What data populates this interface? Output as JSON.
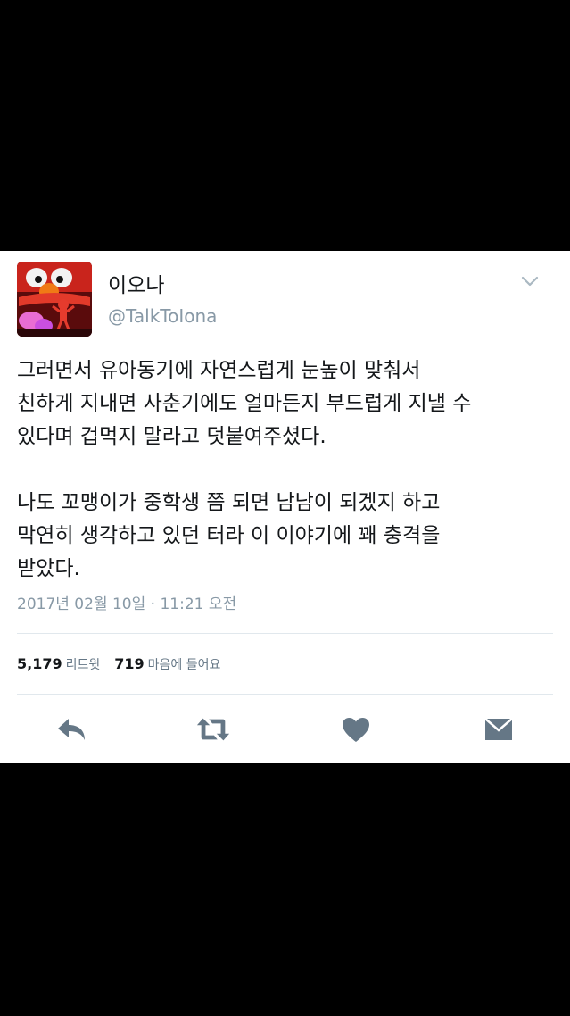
{
  "tweet": {
    "display_name": "이오나",
    "handle": "@TalkToIona",
    "paragraphs": [
      "그러면서 유아동기에 자연스럽게 눈높이 맞춰서\n친하게 지내면 사춘기에도 얼마든지 부드럽게 지낼 수\n있다며 겁먹지 말라고 덧붙여주셨다.",
      "나도 꼬맹이가 중학생 쯤 되면 남남이 되겠지 하고\n막연히 생각하고 있던 터라 이 이야기에 꽤 충격을\n받았다."
    ],
    "timestamp": "2017년 02월 10일 · 11:21 오전",
    "retweet_count": "5,179",
    "retweet_label": "리트윗",
    "like_count": "719",
    "like_label": "마음에 들어요"
  },
  "icons": {
    "avatar": "elmo-avatar",
    "menu": "chevron-down-icon",
    "reply": "reply-icon",
    "retweet": "retweet-icon",
    "like": "heart-icon",
    "dm": "envelope-icon"
  },
  "colors": {
    "text": "#14171a",
    "secondary": "#8899a6",
    "icon": "#657786",
    "divider": "#e1e8ed",
    "background": "#000000"
  }
}
